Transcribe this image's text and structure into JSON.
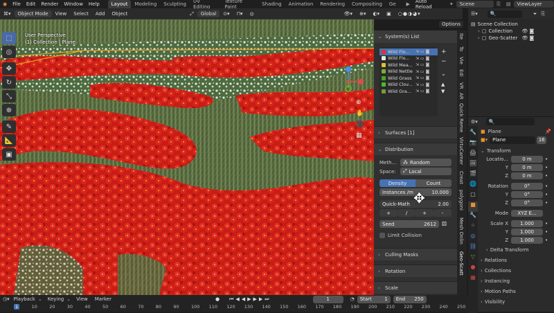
{
  "menubar": {
    "items": [
      "File",
      "Edit",
      "Render",
      "Window",
      "Help"
    ],
    "tabs": [
      "Layout",
      "Modeling",
      "Sculpting",
      "UV Editing",
      "Texture Paint",
      "Shading",
      "Animation",
      "Rendering",
      "Compositing",
      "Ge"
    ],
    "active_tab": "Layout",
    "auto_reload": "Auto Reload",
    "scene": "Scene",
    "view_layer": "ViewLayer"
  },
  "header": {
    "mode": "Object Mode",
    "menus": [
      "View",
      "Select",
      "Add",
      "Object"
    ],
    "transform": "Global",
    "options": "Options"
  },
  "viewport": {
    "title_line1": "User Perspective",
    "title_line2": "(1) Collection | Plane"
  },
  "npanel": {
    "systems_title": "System(s) List",
    "systems": [
      {
        "name": "Wild Flo...",
        "color": "#e03030"
      },
      {
        "name": "Wild Flo...",
        "color": "#e8e8e8"
      },
      {
        "name": "Wild Mea...",
        "color": "#e0c030"
      },
      {
        "name": "Wild Nettle",
        "color": "#7ab030"
      },
      {
        "name": "Wild Grass",
        "color": "#50a030"
      },
      {
        "name": "Wild Clov...",
        "color": "#40c030"
      },
      {
        "name": "Wild Gra...",
        "color": "#7a9a40"
      }
    ],
    "surfaces": "Surfaces [1]",
    "distribution": "Distribution",
    "method_label": "Meth...",
    "method_value": "Random",
    "space_label": "Space:",
    "space_value": "Local",
    "density_tab": "Density",
    "count_tab": "Count",
    "instances_label": "Instances /m",
    "instances_value": "10.000",
    "quickmath_label": "Quick-Math",
    "quickmath_value": "2.00",
    "qm_ops": [
      "+",
      "/",
      "+",
      "-"
    ],
    "seed_label": "Seed",
    "seed_value": "2612",
    "limit_collision": "Limit Collision",
    "culling": "Culling Masks",
    "rotation": "Rotation",
    "scale": "Scale"
  },
  "sidetabs": [
    "Ite",
    "To",
    "Vie",
    "Edi",
    "VR",
    "AR",
    "Quick Reme",
    "VirtuCamer",
    "Creat",
    "polygoni",
    "Mesh Onlin",
    "Geo-Scatt"
  ],
  "outliner": {
    "scene_collection": "Scene Collection",
    "items": [
      "Collection",
      "Geo-Scatter"
    ]
  },
  "properties": {
    "object": "Plane",
    "name": "Plane",
    "users": "16",
    "transform": "Transform",
    "location_label": "Locatio...",
    "location": [
      "0 m",
      "0 m",
      "0 m"
    ],
    "rotation_label": "Rotation",
    "rotation": [
      "0°",
      "0°",
      "0°"
    ],
    "mode_label": "Mode",
    "mode_value": "XYZ E...",
    "scale_label": "Scale X",
    "scale": [
      "1.000",
      "1.000",
      "1.000"
    ],
    "axes": [
      "X",
      "Y",
      "Z"
    ],
    "subsections": [
      "Delta Transform",
      "Relations",
      "Collections",
      "Instancing",
      "Motion Paths",
      "Visibility"
    ]
  },
  "timeline": {
    "menus": [
      "Playback",
      "Keying",
      "View",
      "Marker"
    ],
    "frame": "1",
    "start_label": "Start",
    "start": "1",
    "end_label": "End",
    "end": "250",
    "ticks": [
      "1",
      "10",
      "20",
      "30",
      "40",
      "50",
      "60",
      "70",
      "80",
      "90",
      "100",
      "110",
      "120",
      "130",
      "140",
      "150",
      "160",
      "170",
      "180",
      "190",
      "200",
      "210",
      "220",
      "230",
      "240",
      "250"
    ]
  }
}
